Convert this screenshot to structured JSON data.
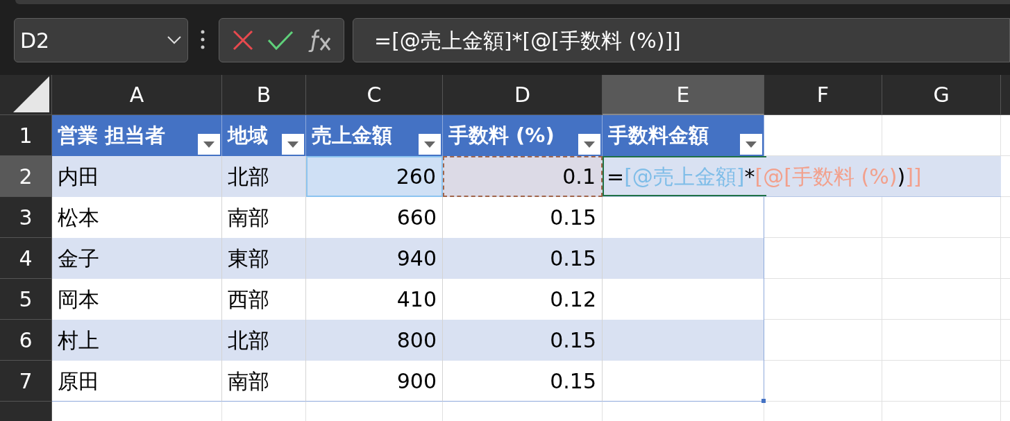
{
  "name_box": {
    "value": "D2"
  },
  "formula_bar": {
    "value": "=[@売上金額]*[@[手数料 (%)]]"
  },
  "columns": [
    {
      "label": "A",
      "selected": false
    },
    {
      "label": "B",
      "selected": false
    },
    {
      "label": "C",
      "selected": false
    },
    {
      "label": "D",
      "selected": false
    },
    {
      "label": "E",
      "selected": true
    },
    {
      "label": "F",
      "selected": false
    },
    {
      "label": "G",
      "selected": false
    }
  ],
  "table": {
    "headers": [
      "営業 担当者",
      "地域",
      "売上金額",
      "手数料 (%)",
      "手数料金額"
    ],
    "rows": [
      {
        "number": "2",
        "selected": true,
        "cells": [
          {
            "text": "内田"
          },
          {
            "text": "北部"
          },
          {
            "text": "260",
            "color": "#8cc4f0"
          },
          {
            "text": "0.1",
            "color": "#a0644a"
          },
          {
            "editing": true,
            "tokens": [
              {
                "text": "=",
                "color": "#000000"
              },
              {
                "text": "[@売上金額]",
                "color": "#7fbde8"
              },
              {
                "text": "*",
                "color": "#000000"
              },
              {
                "text": "[@[手数料 (%)",
                "color": "#f2a08c"
              },
              {
                "text": ")",
                "color": "#000000"
              },
              {
                "text": "]]",
                "color": "#f2a08c"
              }
            ]
          }
        ]
      },
      {
        "number": "3",
        "selected": false,
        "cells": [
          {
            "text": "松本"
          },
          {
            "text": "南部"
          },
          {
            "text": "660"
          },
          {
            "text": "0.15"
          },
          {
            "text": ""
          }
        ]
      },
      {
        "number": "4",
        "selected": false,
        "cells": [
          {
            "text": "金子"
          },
          {
            "text": "東部"
          },
          {
            "text": "940"
          },
          {
            "text": "0.15"
          },
          {
            "text": ""
          }
        ]
      },
      {
        "number": "5",
        "selected": false,
        "cells": [
          {
            "text": "岡本"
          },
          {
            "text": "西部"
          },
          {
            "text": "410"
          },
          {
            "text": "0.12"
          },
          {
            "text": ""
          }
        ]
      },
      {
        "number": "6",
        "selected": false,
        "cells": [
          {
            "text": "村上"
          },
          {
            "text": "北部"
          },
          {
            "text": "800"
          },
          {
            "text": "0.15"
          },
          {
            "text": ""
          }
        ]
      },
      {
        "number": "7",
        "selected": false,
        "cells": [
          {
            "text": "原田"
          },
          {
            "text": "南部"
          },
          {
            "text": "900"
          },
          {
            "text": "0.15"
          },
          {
            "text": ""
          }
        ]
      }
    ]
  },
  "header_row_number": "1"
}
